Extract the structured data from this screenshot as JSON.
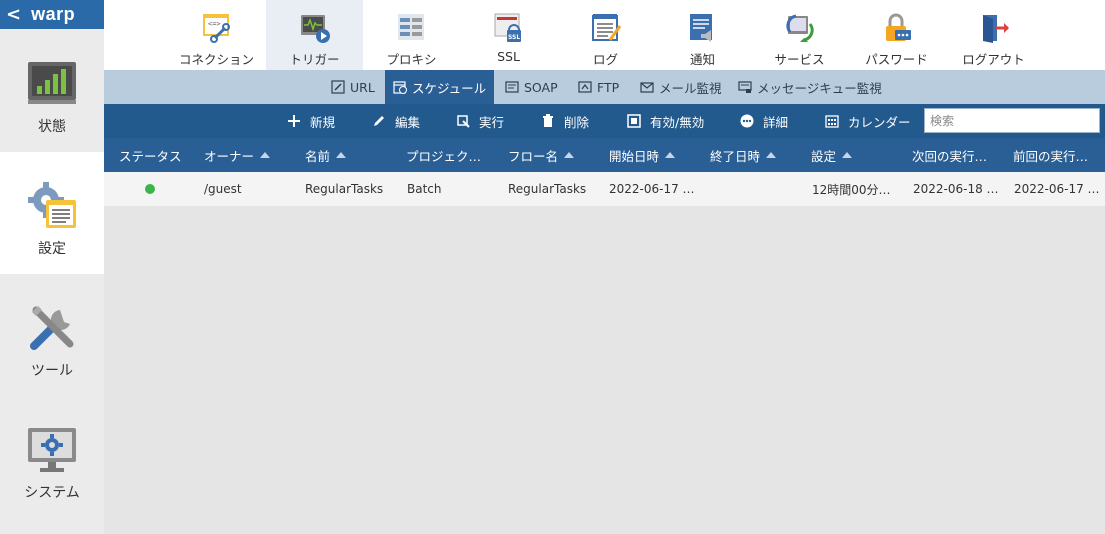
{
  "brand": {
    "name": "warp"
  },
  "sidebar": {
    "items": [
      {
        "label": "状態",
        "icon": "bar-chart-icon"
      },
      {
        "label": "設定",
        "icon": "settings-gear-icon"
      },
      {
        "label": "ツール",
        "icon": "tools-icon"
      },
      {
        "label": "システム",
        "icon": "monitor-gear-icon"
      }
    ],
    "active": "設定"
  },
  "toolbar": {
    "items": [
      {
        "label": "コネクション",
        "icon": "connection-icon"
      },
      {
        "label": "トリガー",
        "icon": "trigger-icon"
      },
      {
        "label": "プロキシ",
        "icon": "proxy-icon"
      },
      {
        "label": "SSL",
        "icon": "ssl-icon"
      },
      {
        "label": "ログ",
        "icon": "log-icon"
      },
      {
        "label": "通知",
        "icon": "notification-icon"
      },
      {
        "label": "サービス",
        "icon": "service-icon"
      },
      {
        "label": "パスワード",
        "icon": "password-icon"
      },
      {
        "label": "ログアウト",
        "icon": "logout-icon"
      }
    ],
    "active": "トリガー"
  },
  "subtabs": {
    "items": [
      {
        "label": "URL",
        "icon": "link-icon"
      },
      {
        "label": "スケジュール",
        "icon": "schedule-icon"
      },
      {
        "label": "SOAP",
        "icon": "soap-icon"
      },
      {
        "label": "FTP",
        "icon": "ftp-icon"
      },
      {
        "label": "メール監視",
        "icon": "mail-icon"
      },
      {
        "label": "メッセージキュー監視",
        "icon": "message-queue-icon"
      }
    ],
    "active": "スケジュール"
  },
  "actions": {
    "new": "新規",
    "edit": "編集",
    "run": "実行",
    "delete": "削除",
    "toggle": "有効/無効",
    "detail": "詳細",
    "calendar": "カレンダー",
    "search_placeholder": "検索"
  },
  "table": {
    "columns": [
      "ステータス",
      "オーナー",
      "名前",
      "プロジェク…",
      "フロー名",
      "開始日時",
      "終了日時",
      "設定",
      "次回の実行…",
      "前回の実行…"
    ],
    "rows": [
      {
        "status": "enabled",
        "owner": "/guest",
        "name": "RegularTasks",
        "project": "Batch",
        "flow": "RegularTasks",
        "start": "2022-06-17 …",
        "end": "",
        "setting": "12時間00分…",
        "next": "2022-06-18 …",
        "prev": "2022-06-17 …"
      }
    ]
  },
  "colors": {
    "brand_blue": "#2b6aa8",
    "header_blue": "#2a5f96",
    "action_blue": "#235a8e",
    "subtab_bg": "#b9ccde",
    "status_green": "#3bb54a"
  }
}
